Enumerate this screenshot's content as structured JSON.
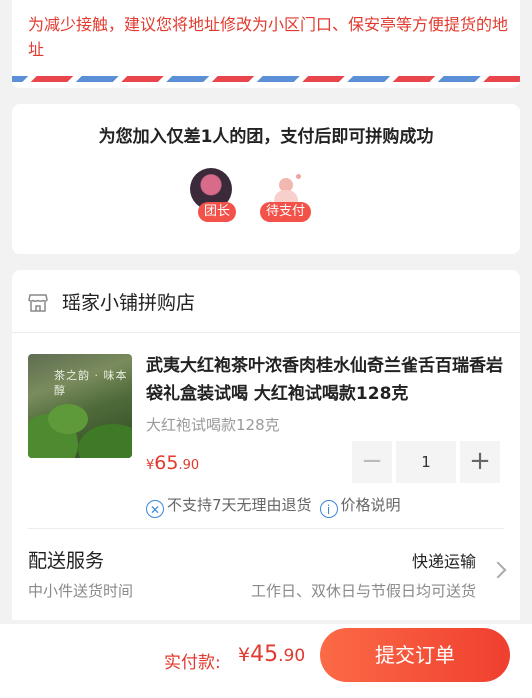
{
  "address": {
    "warning": "为减少接触，建议您将地址修改为小区门口、保安亭等方便提货的地址"
  },
  "group": {
    "title": "为您加入仅差1人的团，支付后即可拼购成功",
    "leader_tag": "团长",
    "pending_tag": "待支付"
  },
  "store": {
    "name": "瑶家小铺拼购店",
    "product": {
      "title": "武夷大红袍茶叶浓香肉桂水仙奇兰雀舌百瑞香岩袋礼盒装试喝 大红袍试喝款128克",
      "image_text": "茶之韵 · 味本醇",
      "sku": "大红袍试喝款128克",
      "price": {
        "currency": "¥",
        "integer": "65",
        "decimal": ".90"
      },
      "quantity": "1",
      "minus_label": "−",
      "plus_label": "+",
      "no_return_text": "不支持7天无理由退货",
      "price_note_text": "价格说明"
    },
    "delivery": {
      "title": "配送服务",
      "subtitle": "中小件送货时间",
      "method": "快递运输",
      "time": "工作日、双休日与节假日均可送货"
    }
  },
  "checkout": {
    "pay_label": "实付款:",
    "amount": {
      "currency": "¥",
      "integer": "45",
      "decimal": ".90"
    },
    "submit_label": "提交订单"
  },
  "colors": {
    "accent_red": "#e23a2e",
    "button_gradient_start": "#fb6a46",
    "button_gradient_end": "#f03f2f",
    "info_blue": "#3c86d8"
  },
  "icons": {
    "shop": "store-icon",
    "no_return": "no-return-icon",
    "info": "info-icon",
    "chevron": "chevron-right-icon"
  }
}
